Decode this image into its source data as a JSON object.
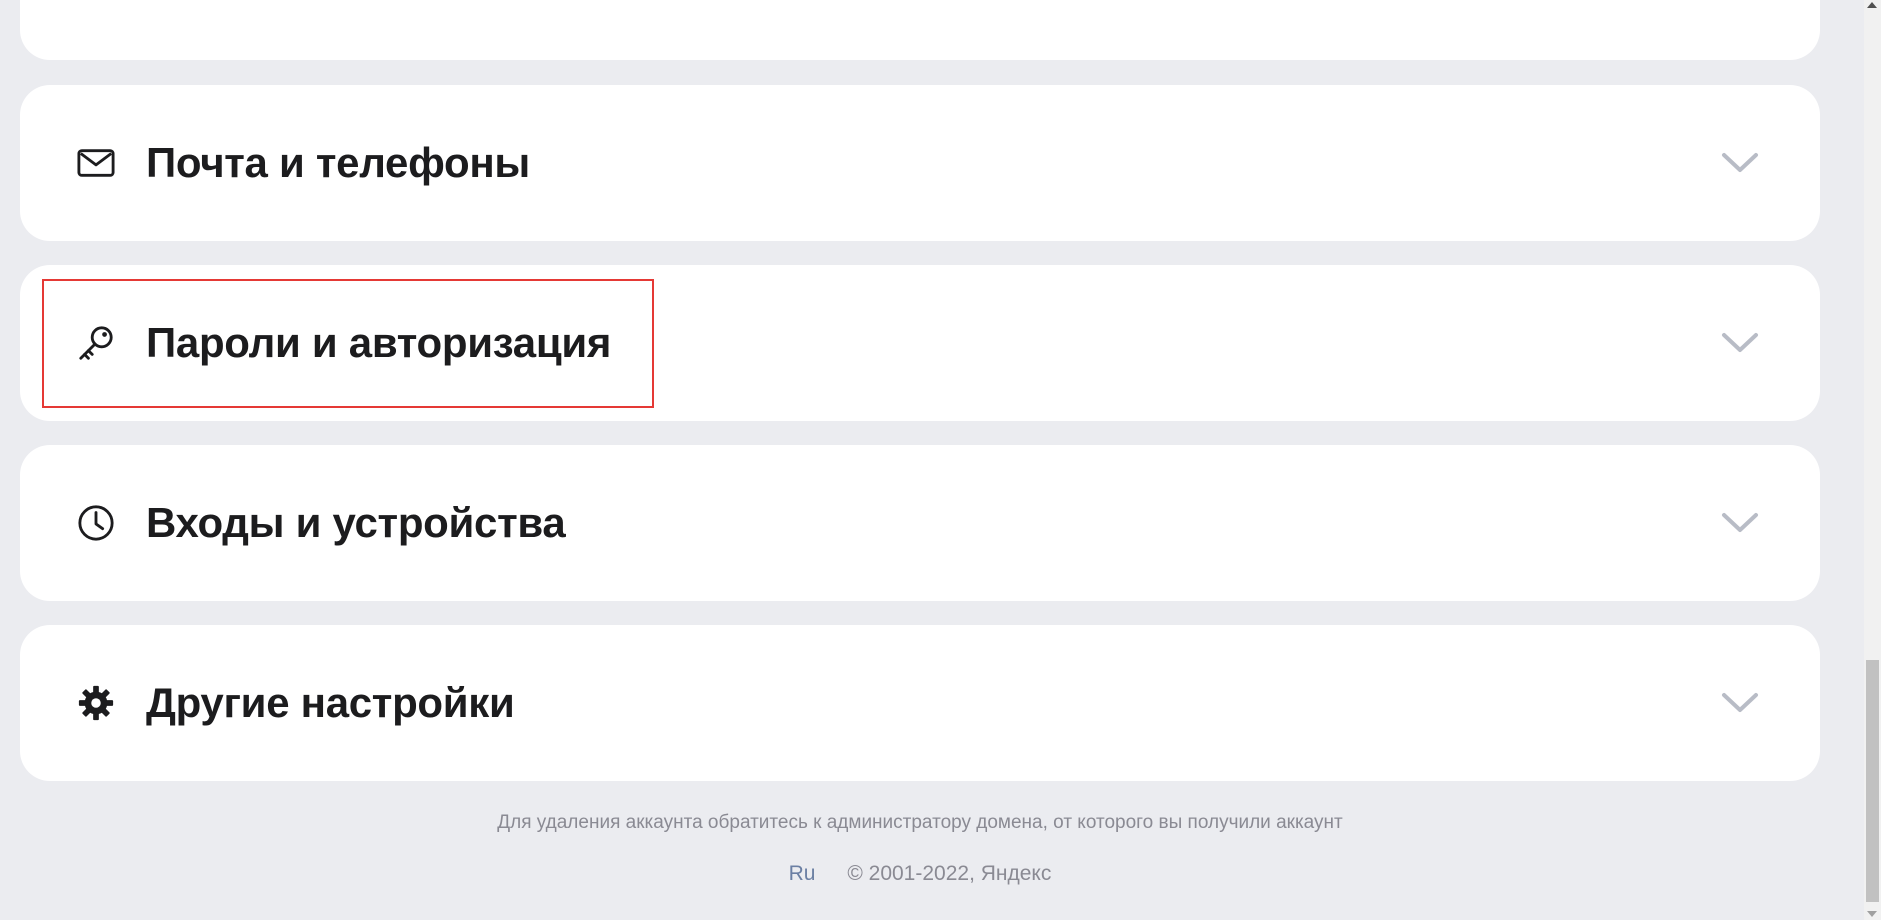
{
  "sections": [
    {
      "title": "Почта и телефоны",
      "icon": "mail-icon"
    },
    {
      "title": "Пароли и авторизация",
      "icon": "key-icon"
    },
    {
      "title": "Входы и устройства",
      "icon": "clock-icon"
    },
    {
      "title": "Другие настройки",
      "icon": "gear-icon"
    }
  ],
  "footer": {
    "note": "Для удаления аккаунта обратитесь к администратору домена, от которого вы получили аккаунт",
    "lang": "Ru",
    "copyright": "© 2001-2022, Яндекс"
  },
  "colors": {
    "background": "#ebecf0",
    "card": "#ffffff",
    "chevron": "#b8bcc6",
    "highlight": "#e53935",
    "footer_text": "#8a8a93"
  }
}
